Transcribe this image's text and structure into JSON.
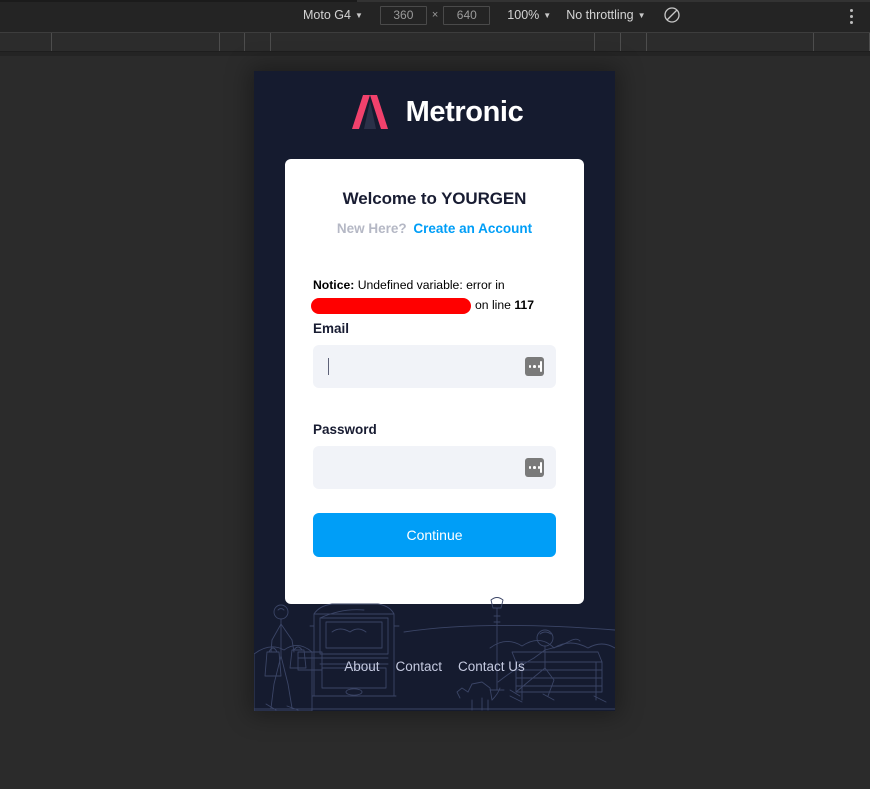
{
  "devtools": {
    "device_name": "Moto G4",
    "width_value": "360",
    "height_value": "640",
    "dim_separator": "×",
    "zoom_value": "100%",
    "throttling_value": "No throttling",
    "caret_glyph": "▼",
    "rotate_icon": "rotate-device-icon",
    "more_icon": "more-options-icon",
    "backdrop_color": "#2b2b2b",
    "toolbar_color": "#242424"
  },
  "page": {
    "background_color": "#151b2f",
    "brand": {
      "logo_icon": "metronic-logo-icon",
      "logo_color": "#f1416c",
      "name": "Metronic"
    },
    "card": {
      "title": "Welcome to YOURGEN",
      "subtitle_prefix": "New Here?",
      "signup_link": "Create an Account",
      "accent_color": "#009ef7",
      "notice": {
        "label": "Notice",
        "label_suffix": ":",
        "message": " Undefined variable: error in",
        "redacted_path": "",
        "tail_prefix": "on line ",
        "line_number": "117",
        "redaction_color": "#ff0000"
      },
      "fields": [
        {
          "name": "email",
          "label": "Email",
          "value": "",
          "placeholder": "",
          "focused": true,
          "autofill_icon": "autofill-icon"
        },
        {
          "name": "password",
          "label": "Password",
          "value": "",
          "placeholder": "",
          "focused": false,
          "autofill_icon": "autofill-icon"
        }
      ],
      "submit_label": "Continue"
    },
    "footer": {
      "illustration_icon": "city-scene-line-art-illustration",
      "links": [
        {
          "label": "About"
        },
        {
          "label": "Contact"
        },
        {
          "label": "Contact Us"
        }
      ]
    }
  }
}
